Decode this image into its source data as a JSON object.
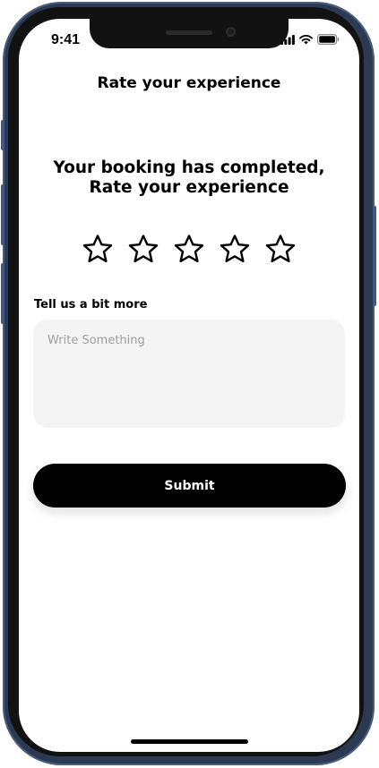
{
  "status_bar": {
    "time": "9:41",
    "icons": [
      "signal-icon",
      "wifi-icon",
      "battery-icon"
    ]
  },
  "header": {
    "title": "Rate your experience"
  },
  "main": {
    "heading": "Your booking has completed, Rate your experience",
    "rating": {
      "max": 5,
      "value": 0,
      "icon": "star-outline-icon"
    },
    "feedback": {
      "label": "Tell us a bit more",
      "placeholder": "Write Something",
      "value": ""
    },
    "submit_label": "Submit"
  },
  "colors": {
    "primary": "#000000",
    "input_background": "#f4f4f4",
    "placeholder": "#9e9e9e",
    "device_frame": "#2b3a52"
  }
}
